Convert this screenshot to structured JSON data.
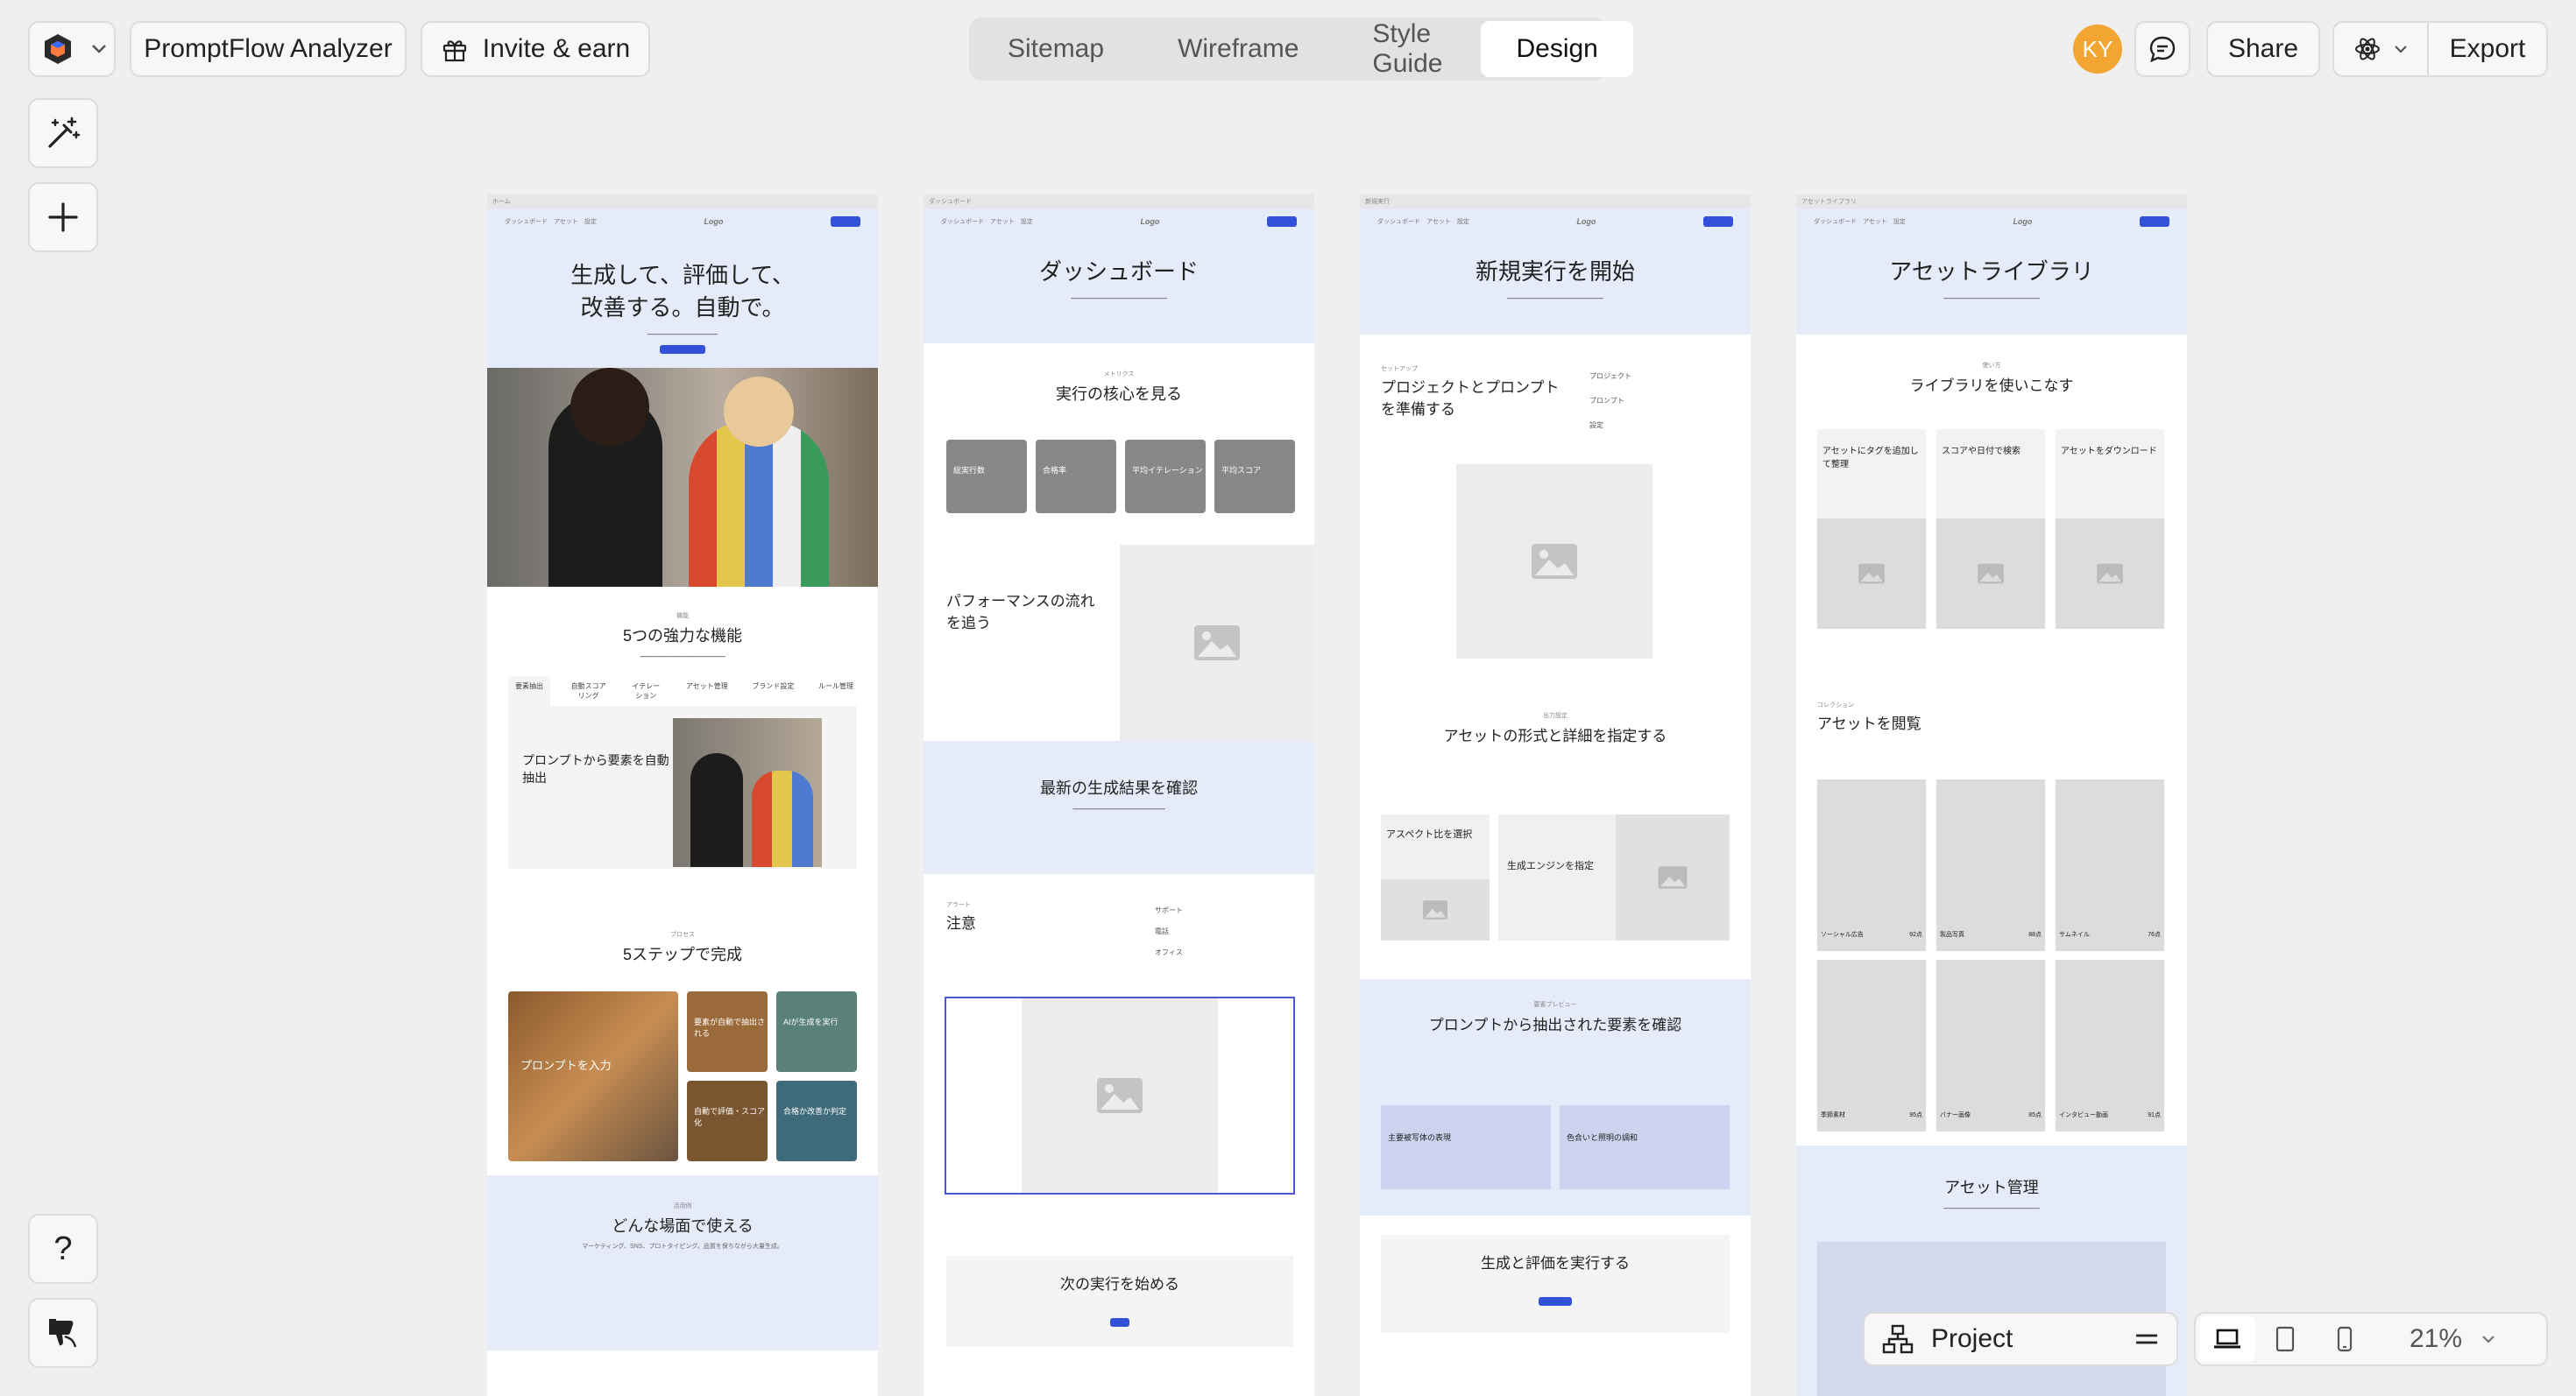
{
  "topbar": {
    "project_name": "PromptFlow Analyzer",
    "invite_label": "Invite & earn",
    "tabs": [
      "Sitemap",
      "Wireframe",
      "Style Guide",
      "Design"
    ],
    "active_tab": "Design",
    "avatar_initials": "KY",
    "share_label": "Share",
    "export_label": "Export"
  },
  "left_tools": {
    "help_label": "?"
  },
  "frames": {
    "home": {
      "tab_title": "ホーム",
      "logo": "Logo",
      "hero_title_1": "生成して、評価して、",
      "hero_title_2": "改善する。自動で。",
      "features_eyebrow": "機能",
      "features_title": "5つの強力な機能",
      "feature_tabs": [
        "要素抽出",
        "自動スコアリング",
        "イテレーション",
        "アセット管理",
        "ブランド設定",
        "ルール管理"
      ],
      "feature_card_title": "プロンプトから要素を自動抽出",
      "steps_eyebrow": "プロセス",
      "steps_title": "5ステップで完成",
      "step_main": "プロンプトを入力",
      "step_2": "要素が自動で抽出される",
      "step_3": "AIが生成を実行",
      "step_4": "自動で評価・スコア化",
      "step_5": "合格か改善か判定",
      "usecase_eyebrow": "活用例",
      "usecase_title": "どんな場面で使える",
      "usecase_sub": "マーケティング、SNS、プロトタイピング。品質を保ちながら大量生成。"
    },
    "dashboard": {
      "tab_title": "ダッシュボード",
      "hero_title": "ダッシュボード",
      "metrics_eyebrow": "メトリクス",
      "metrics_title": "実行の核心を見る",
      "metric_cards": [
        "総実行数",
        "合格率",
        "平均イテレーション",
        "平均スコア"
      ],
      "flow_title": "パフォーマンスの流れを追う",
      "results_title": "最新の生成結果を確認",
      "notice_eyebrow": "アラート",
      "notice_title": "注意",
      "support_label": "サポート",
      "phone_label": "電話",
      "office_label": "オフィス",
      "next_title": "次の実行を始める"
    },
    "newrun": {
      "tab_title": "新規実行",
      "hero_title": "新規実行を開始",
      "setup_eyebrow": "セットアップ",
      "setup_title": "プロジェクトとプロンプトを準備する",
      "side_items": [
        "プロジェクト",
        "プロンプト",
        "設定"
      ],
      "format_eyebrow": "出力設定",
      "format_title": "アセットの形式と詳細を指定する",
      "aspect_title": "アスペクト比を選択",
      "engine_title": "生成エンジンを指定",
      "extract_eyebrow": "要素プレビュー",
      "extract_title": "プロンプトから抽出された要素を確認",
      "extract_card_1": "主要被写体の表現",
      "extract_card_2": "色合いと照明の調和",
      "run_title": "生成と評価を実行する"
    },
    "library": {
      "tab_title": "アセットライブラリ",
      "hero_title": "アセットライブラリ",
      "use_eyebrow": "使い方",
      "use_title": "ライブラリを使いこなす",
      "use_cards": [
        "アセットにタグを追加して整理",
        "スコアや日付で検索",
        "アセットをダウンロード"
      ],
      "browse_eyebrow": "コレクション",
      "browse_title": "アセットを閲覧",
      "asset_names": [
        "ソーシャル広告",
        "製品写真",
        "サムネイル",
        "季節素材",
        "バナー画像",
        "インタビュー動画"
      ],
      "asset_scores": [
        "92点",
        "88点",
        "76点",
        "95点",
        "85点",
        "91点"
      ],
      "manage_title": "アセット管理"
    }
  },
  "bottom_bar": {
    "project_label": "Project",
    "zoom": "21%"
  }
}
